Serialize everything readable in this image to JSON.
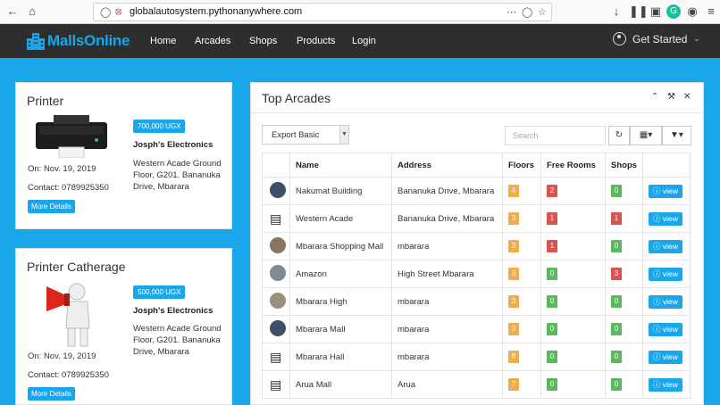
{
  "browser": {
    "url_host": "globalautosystem.pythonanywhere.com",
    "icons": [
      "back-arrow-icon",
      "home-icon",
      "shield-icon",
      "insecure-lock-icon",
      "more-dots-icon",
      "pocket-icon",
      "bookmark-star-icon",
      "download-icon",
      "library-icon",
      "reader-icon",
      "grammarly-icon",
      "account-icon",
      "overflow-menu-icon"
    ]
  },
  "navbar": {
    "brand": "MallsOnline",
    "links": [
      "Home",
      "Arcades",
      "Shops",
      "Products",
      "Login"
    ],
    "get_started": "Get Started"
  },
  "products": [
    {
      "title": "Printer",
      "price": "700,000 UGX",
      "seller": "Josph's Electronics",
      "address": "Western Acade Ground Floor, G201. Bananuka Drive, Mbarara",
      "date": "On: Nov. 19, 2019",
      "contact": "Contact: 0789925350",
      "button": "More Details"
    },
    {
      "title": "Printer Catherage",
      "price": "500,000 UGX",
      "seller": "Josph's Electronics",
      "address": "Western Acade Ground Floor, G201. Bananuka Drive, Mbarara",
      "date": "On: Nov. 19, 2019",
      "contact": "Contact: 0789925350",
      "button": "More Details"
    }
  ],
  "panel": {
    "title": "Top Arcades",
    "export_label": "Export Basic",
    "search_placeholder": "Search",
    "headers": [
      "Name",
      "Address",
      "Floors",
      "Free Rooms",
      "Shops"
    ],
    "rows": [
      {
        "thumb": "photo",
        "name": "Nakumat Building",
        "address": "Bananuka Drive, Mbarara",
        "floors": "4",
        "free_rooms": "2",
        "shops": "0",
        "floors_color": "#f0ad4e",
        "rooms_color": "#d9534f",
        "shops_color": "#5cb85c",
        "view": "view"
      },
      {
        "thumb": "building-icon",
        "name": "Western Acade",
        "address": "Bananuka Drive, Mbarara",
        "floors": "3",
        "free_rooms": "1",
        "shops": "1",
        "floors_color": "#f0ad4e",
        "rooms_color": "#d9534f",
        "shops_color": "#d9534f",
        "view": "view"
      },
      {
        "thumb": "photo",
        "name": "Mbarara Shopping Mall",
        "address": "mbarara",
        "floors": "3",
        "free_rooms": "1",
        "shops": "0",
        "floors_color": "#f0ad4e",
        "rooms_color": "#d9534f",
        "shops_color": "#5cb85c",
        "view": "view"
      },
      {
        "thumb": "photo",
        "name": "Amazon",
        "address": "High Street Mbarara",
        "floors": "3",
        "free_rooms": "0",
        "shops": "3",
        "floors_color": "#f0ad4e",
        "rooms_color": "#5cb85c",
        "shops_color": "#d9534f",
        "view": "view"
      },
      {
        "thumb": "photo",
        "name": "Mbarara High",
        "address": "mbarara",
        "floors": "3",
        "free_rooms": "0",
        "shops": "0",
        "floors_color": "#f0ad4e",
        "rooms_color": "#5cb85c",
        "shops_color": "#5cb85c",
        "view": "view"
      },
      {
        "thumb": "photo",
        "name": "Mbarara Mall",
        "address": "mbarara",
        "floors": "3",
        "free_rooms": "0",
        "shops": "0",
        "floors_color": "#f0ad4e",
        "rooms_color": "#5cb85c",
        "shops_color": "#5cb85c",
        "view": "view"
      },
      {
        "thumb": "building-icon",
        "name": "Mbarara Hall",
        "address": "mbarara",
        "floors": "8",
        "free_rooms": "0",
        "shops": "0",
        "floors_color": "#f0ad4e",
        "rooms_color": "#5cb85c",
        "shops_color": "#5cb85c",
        "view": "view"
      },
      {
        "thumb": "building-icon",
        "name": "Arua Mall",
        "address": "Arua",
        "floors": "7",
        "free_rooms": "0",
        "shops": "0",
        "floors_color": "#f0ad4e",
        "rooms_color": "#5cb85c",
        "shops_color": "#5cb85c",
        "view": "view"
      }
    ]
  },
  "colors": {
    "accent": "#1aa6ea",
    "navbar": "#2e2e2e",
    "orange": "#f0ad4e",
    "red": "#d9534f",
    "green": "#5cb85c"
  }
}
